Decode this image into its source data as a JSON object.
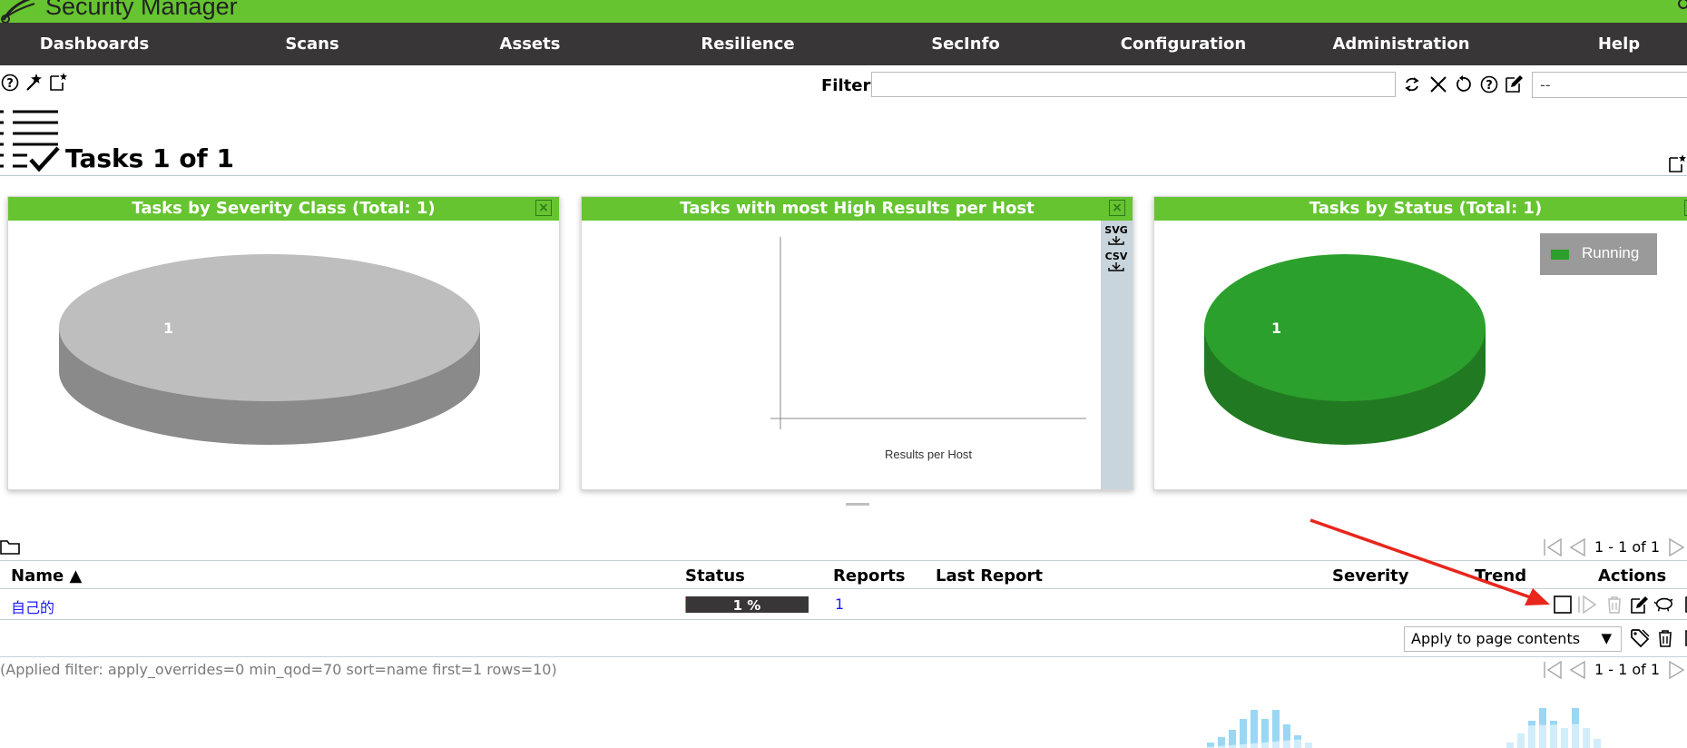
{
  "app": {
    "title": "Security Manager"
  },
  "nav": {
    "items": [
      "Dashboards",
      "Scans",
      "Assets",
      "Resilience",
      "SecInfo",
      "Configuration",
      "Administration",
      "Help"
    ]
  },
  "toolbar": {
    "filter_label": "Filter",
    "filter_value": "",
    "filter_select_value": "--",
    "icons": [
      "help-icon",
      "wizard-icon",
      "new-task-icon"
    ],
    "filter_icons": [
      "refresh-icon",
      "clear-icon",
      "reset-icon",
      "help-icon",
      "edit-filter-icon"
    ]
  },
  "page": {
    "title": "Tasks 1 of 1"
  },
  "panels": [
    {
      "title": "Tasks by Severity Class (Total: 1)",
      "slice_label": "1",
      "color": "#bebebe"
    },
    {
      "title": "Tasks with most High Results per Host",
      "xlabel": "Results per Host",
      "export": [
        "SVG",
        "CSV"
      ]
    },
    {
      "title": "Tasks by Status (Total: 1)",
      "slice_label": "1",
      "legend": "Running",
      "color": "#2ca02c"
    }
  ],
  "table": {
    "headers": {
      "name": "Name ▲",
      "status": "Status",
      "reports": "Reports",
      "last_report": "Last Report",
      "severity": "Severity",
      "trend": "Trend",
      "actions": "Actions"
    },
    "rows": [
      {
        "name": "自己的",
        "status": "1 %",
        "progress": 0.01,
        "reports": "1",
        "last_report": "",
        "severity": "",
        "trend": ""
      }
    ],
    "pager": "1 - 1 of 1",
    "bulk_select": "Apply to page contents",
    "applied_filter": "(Applied filter: apply_overrides=0 min_qod=70 sort=name first=1 rows=10)"
  },
  "colors": {
    "brand": "#66c430",
    "nav": "#393637",
    "link": "#1a1aff"
  }
}
